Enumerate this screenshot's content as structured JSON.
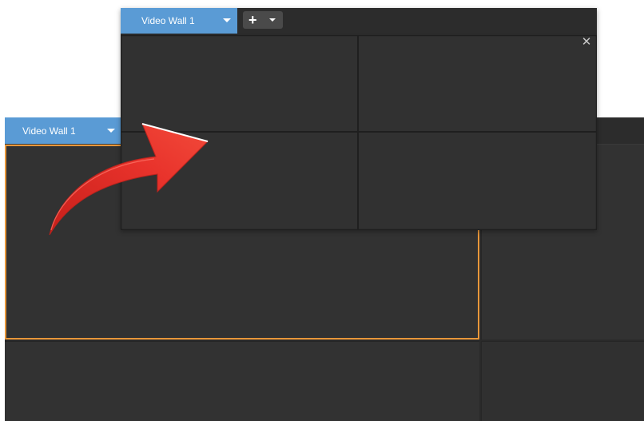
{
  "background_window": {
    "tab_label": "Video Wall 1",
    "tab_caret_icon": "caret-down-icon",
    "selected_cell_color": "#e8973a"
  },
  "foreground_window": {
    "tab_label": "Video Wall 1",
    "tab_caret_icon": "caret-down-icon",
    "add_button": {
      "icon": "plus-icon",
      "glyph": "+",
      "caret_icon": "caret-down-icon"
    },
    "close_glyph": "✕",
    "grid": {
      "rows": 2,
      "columns": 2
    }
  },
  "overlay": {
    "arrow_icon": "curved-arrow-icon",
    "arrow_color": "#e8322b"
  },
  "colors": {
    "tab_blue": "#5a9bd5",
    "panel_dark": "#2a2a2a",
    "cell_dark": "#323232"
  }
}
